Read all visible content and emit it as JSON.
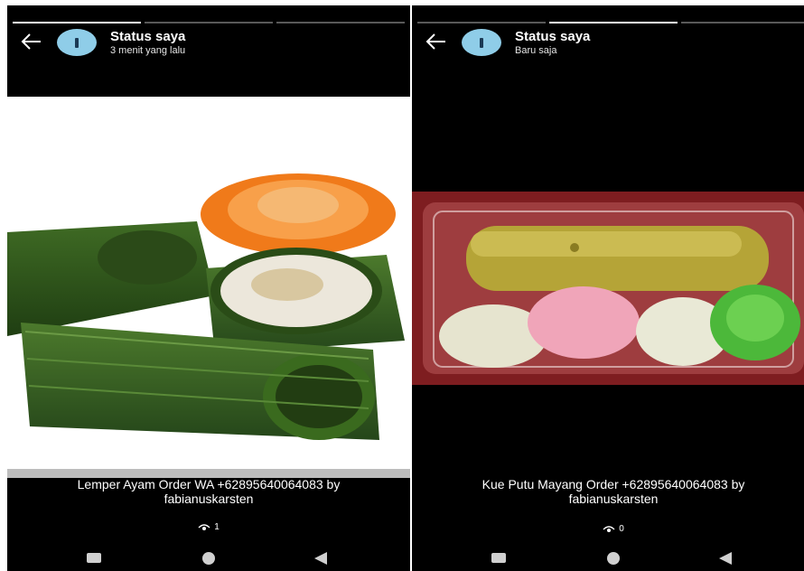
{
  "left": {
    "title": "Status saya",
    "time": "3 menit yang lalu",
    "caption_line1": "Lemper Ayam Order WA +62895640064083 by",
    "caption_line2": "fabianuskarsten",
    "view_count": "1",
    "progress_segments": 3,
    "active_segment": 1
  },
  "right": {
    "title": "Status saya",
    "time": "Baru saja",
    "caption_line1": "Kue Putu Mayang Order +62895640064083 by",
    "caption_line2": "fabianuskarsten",
    "view_count": "0",
    "progress_segments": 3,
    "active_segment": 2
  },
  "icons": {
    "back": "arrow-left-icon",
    "avatar": "avatar-icon",
    "views": "eye-icon",
    "nav_recents": "square-icon",
    "nav_home": "circle-icon",
    "nav_back": "triangle-left-icon"
  },
  "colors": {
    "background": "#000000",
    "avatar": "#8fcde8",
    "text": "#ffffff",
    "nav": "#d0d0d0"
  }
}
